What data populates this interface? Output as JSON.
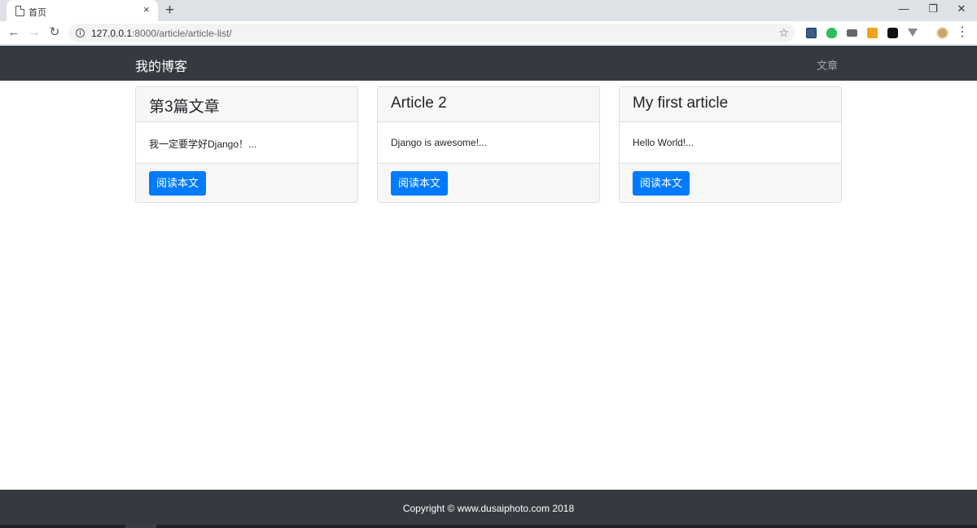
{
  "browser": {
    "tab": {
      "title": "首页",
      "close_glyph": "×",
      "icon": "page-icon"
    },
    "new_tab_glyph": "+",
    "window_controls": {
      "minimize": "—",
      "restore": "❐",
      "close": "✕"
    },
    "nav": {
      "back": "←",
      "forward": "→",
      "reload": "↻"
    },
    "address": {
      "host": "127.0.0.1",
      "path": ":8000/article/article-list/",
      "info_glyph": "i"
    },
    "bookmark_glyph": "☆",
    "extensions": [
      "bookmark-extension-icon",
      "evernote-icon",
      "mail-icon",
      "rss-icon",
      "tampermonkey-icon",
      "vue-devtools-icon",
      "profile-avatar"
    ],
    "menu_glyph": "⋮"
  },
  "site": {
    "brand": "我的博客",
    "nav_link": "文章",
    "articles": [
      {
        "title": "第3篇文章",
        "excerpt": "我一定要学好Django！...",
        "button": "阅读本文"
      },
      {
        "title": "Article 2",
        "excerpt": "Django is awesome!...",
        "button": "阅读本文"
      },
      {
        "title": "My first article",
        "excerpt": "Hello World!...",
        "button": "阅读本文"
      }
    ],
    "footer": "Copyright © www.dusaiphoto.com 2018"
  },
  "colors": {
    "navbar": "#343a40",
    "primary": "#007bff",
    "card_header": "#f7f7f7"
  }
}
